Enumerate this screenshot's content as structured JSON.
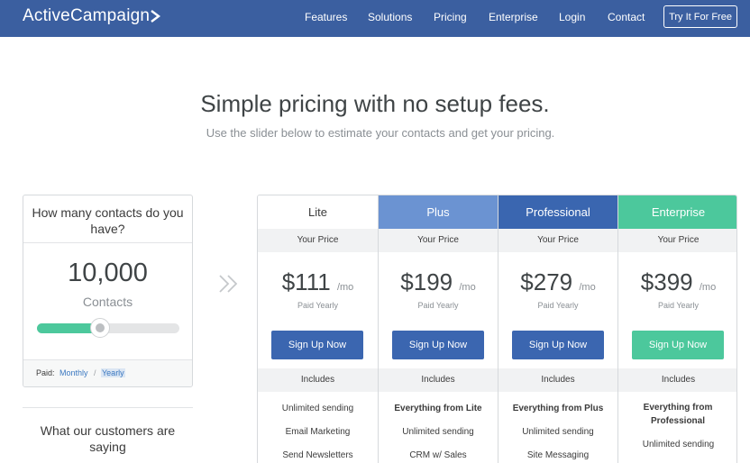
{
  "nav": {
    "logo": "ActiveCampaign",
    "links": [
      "Features",
      "Solutions",
      "Pricing",
      "Enterprise",
      "Login",
      "Contact"
    ],
    "cta": "Try It For Free"
  },
  "hero": {
    "title": "Simple pricing with no setup fees.",
    "subtitle": "Use the slider below to estimate your contacts and get your pricing."
  },
  "contacts": {
    "question": "How many contacts do you have?",
    "count": "10,000",
    "label": "Contacts",
    "slider_fraction": 0.44,
    "paid_label": "Paid:",
    "monthly": "Monthly",
    "separator": "/",
    "yearly": "Yearly"
  },
  "customers": {
    "title": "What our customers are saying"
  },
  "plans": [
    {
      "name": "Lite",
      "header_bg": "#ffffff",
      "header_color": "#3b3b3b",
      "price_label": "Your Price",
      "price": "$111",
      "per": "/mo",
      "paid": "Paid Yearly",
      "button": "Sign Up Now",
      "button_color": "#3b66b0",
      "includes": "Includes",
      "features": [
        {
          "text": "Unlimited sending",
          "bold": false
        },
        {
          "text": "Email Marketing",
          "bold": false
        },
        {
          "text": "Send Newsletters",
          "bold": false
        }
      ]
    },
    {
      "name": "Plus",
      "header_bg": "#6b93d2",
      "header_color": "#ffffff",
      "price_label": "Your Price",
      "price": "$199",
      "per": "/mo",
      "paid": "Paid Yearly",
      "button": "Sign Up Now",
      "button_color": "#3b66b0",
      "includes": "Includes",
      "features": [
        {
          "text": "Everything from Lite",
          "bold": true
        },
        {
          "text": "Unlimited sending",
          "bold": false
        },
        {
          "text": "CRM w/ Sales",
          "bold": false
        }
      ]
    },
    {
      "name": "Professional",
      "header_bg": "#3a66b0",
      "header_color": "#ffffff",
      "price_label": "Your Price",
      "price": "$279",
      "per": "/mo",
      "paid": "Paid Yearly",
      "button": "Sign Up Now",
      "button_color": "#3b66b0",
      "includes": "Includes",
      "features": [
        {
          "text": "Everything from Plus",
          "bold": true
        },
        {
          "text": "Unlimited sending",
          "bold": false
        },
        {
          "text": "Site Messaging",
          "bold": false
        }
      ]
    },
    {
      "name": "Enterprise",
      "header_bg": "#4cc89c",
      "header_color": "#ffffff",
      "price_label": "Your Price",
      "price": "$399",
      "per": "/mo",
      "paid": "Paid Yearly",
      "button": "Sign Up Now",
      "button_color": "#4cc89c",
      "includes": "Includes",
      "features": [
        {
          "text": "Everything from Professional",
          "bold": true
        },
        {
          "text": "Unlimited sending",
          "bold": false
        }
      ]
    }
  ],
  "icons": {
    "logo_mark": "chevron-right-icon",
    "divider_arrows": "double-chevron-right-icon"
  }
}
